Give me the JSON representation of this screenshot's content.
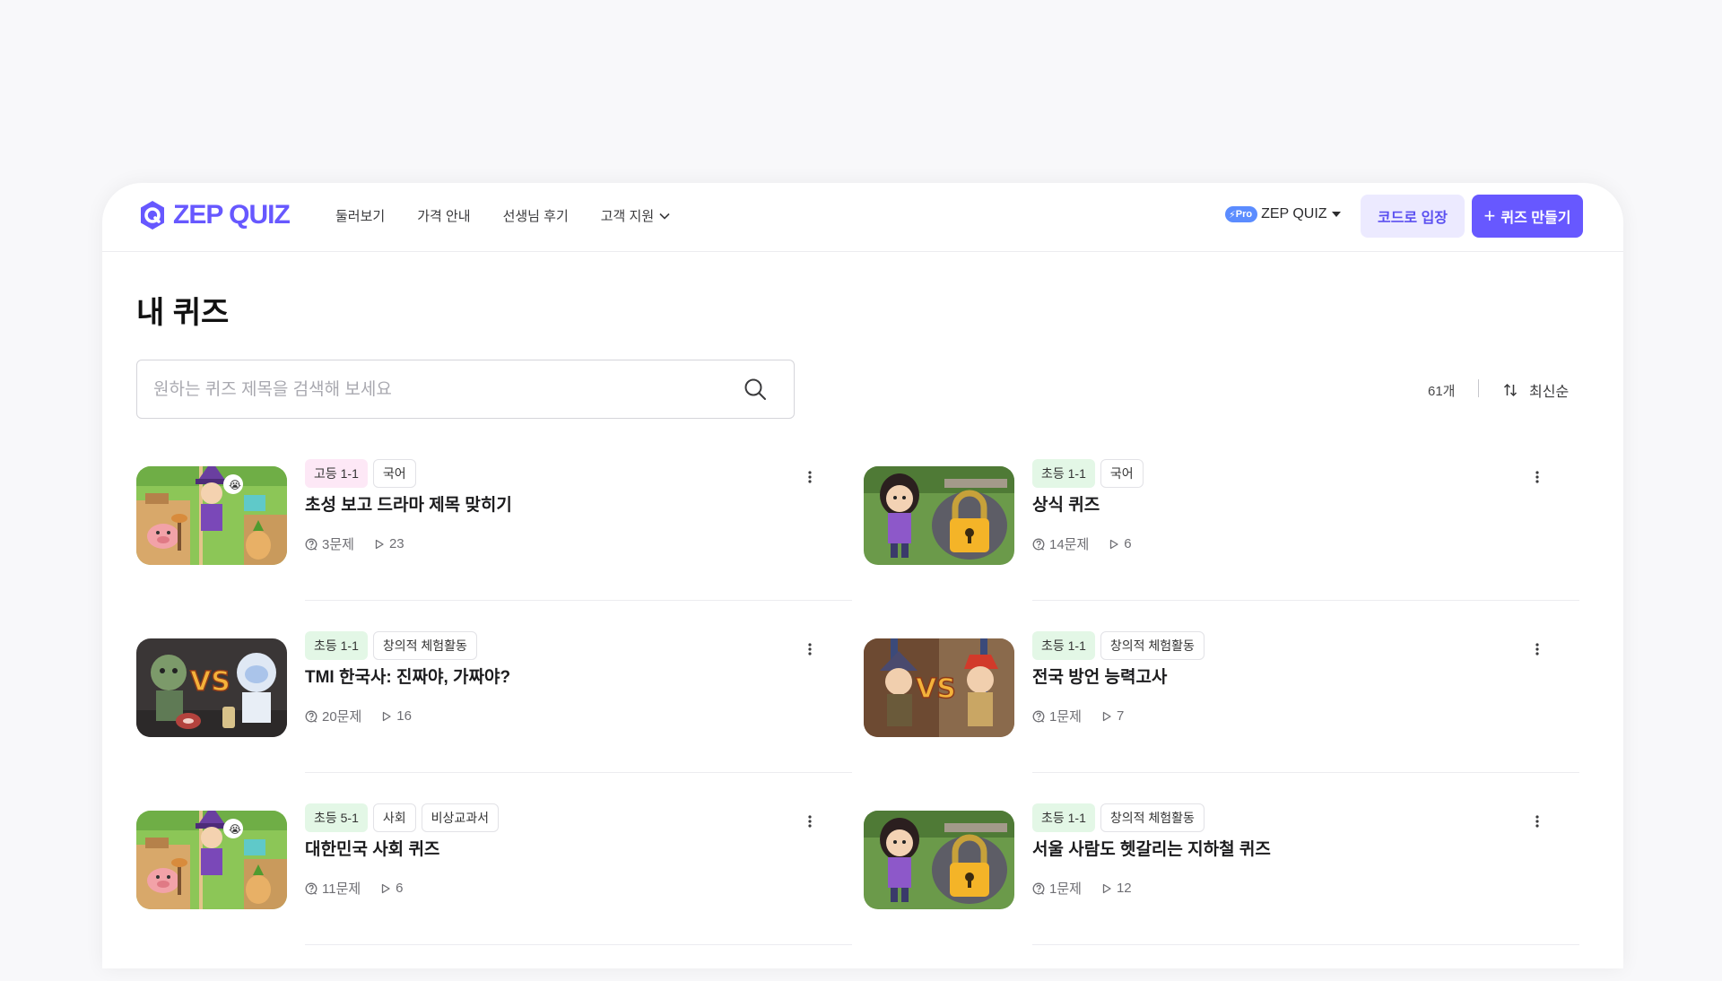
{
  "header": {
    "logo_text": "ZEP QUIZ",
    "nav": [
      "둘러보기",
      "가격 안내",
      "선생님 후기",
      "고객 지원"
    ],
    "plan_badge": "Pro",
    "plan_label": "ZEP QUIZ",
    "code_button": "코드로 입장",
    "make_button": "퀴즈 만들기"
  },
  "page": {
    "title": "내 퀴즈",
    "search_placeholder": "원하는 퀴즈 제목을 검색해 보세요",
    "count": "61개",
    "sort_label": "최신순"
  },
  "quizzes": [
    {
      "tags": [
        "고등 1-1",
        "국어"
      ],
      "title": "초성 보고 드라마 제목 맞히기",
      "questions": "3문제",
      "plays": "23",
      "thumbnail": "witch-pig-garden"
    },
    {
      "tags": [
        "초등 1-1",
        "국어"
      ],
      "title": "상식 퀴즈",
      "questions": "14문제",
      "plays": "6",
      "thumbnail": "girl-padlock"
    },
    {
      "tags": [
        "초등 1-1",
        "창의적 체험활동"
      ],
      "title": "TMI 한국사: 진짜야, 가짜야?",
      "questions": "20문제",
      "plays": "16",
      "thumbnail": "zombie-vs-ghost"
    },
    {
      "tags": [
        "초등 1-1",
        "창의적 체험활동"
      ],
      "title": "전국 방언 능력고사",
      "questions": "1문제",
      "plays": "7",
      "thumbnail": "boys-vs"
    },
    {
      "tags": [
        "초등 5-1",
        "사회",
        "비상교과서"
      ],
      "title": "대한민국 사회 퀴즈",
      "questions": "11문제",
      "plays": "6",
      "thumbnail": "witch-pig-garden"
    },
    {
      "tags": [
        "초등 1-1",
        "창의적 체험활동"
      ],
      "title": "서울 사람도 헷갈리는 지하철 퀴즈",
      "questions": "1문제",
      "plays": "12",
      "thumbnail": "girl-padlock"
    }
  ],
  "colors": {
    "brand": "#6758ff",
    "brand_light": "#eceaff",
    "tag_high": "#fde8f6",
    "tag_elem": "#e3f7e6"
  }
}
